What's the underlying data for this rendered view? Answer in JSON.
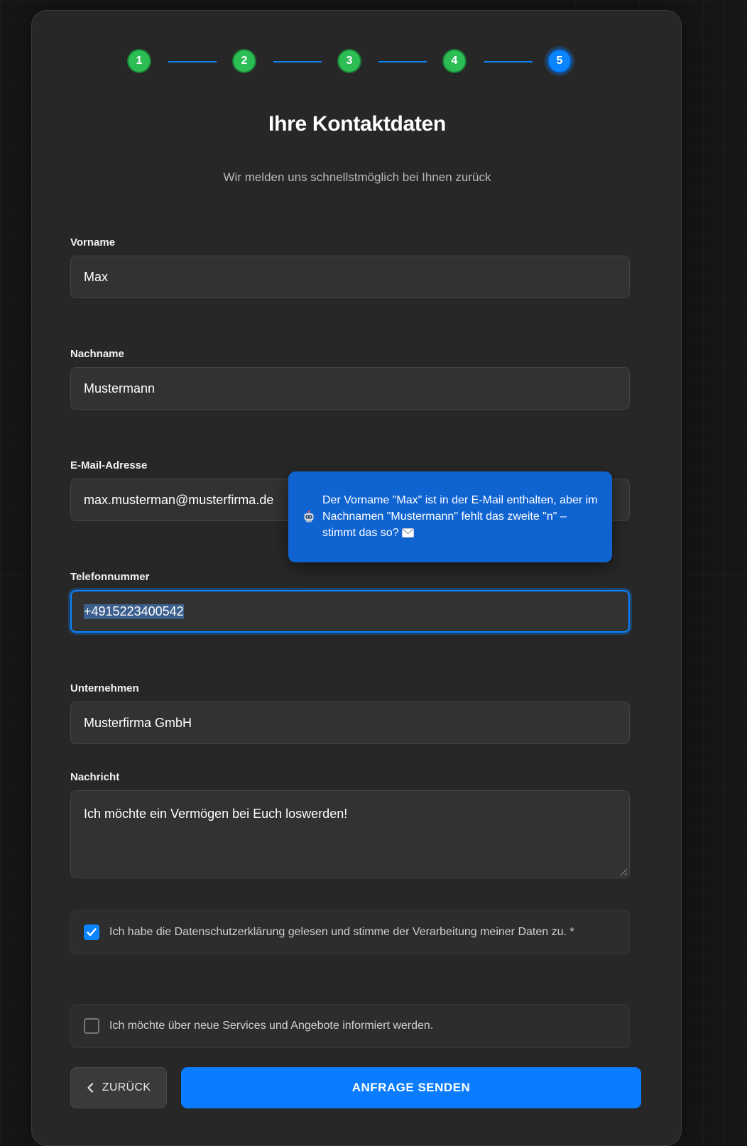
{
  "stepper": {
    "steps": [
      {
        "label": "1",
        "state": "done"
      },
      {
        "label": "2",
        "state": "done"
      },
      {
        "label": "3",
        "state": "done"
      },
      {
        "label": "4",
        "state": "done"
      },
      {
        "label": "5",
        "state": "active"
      }
    ],
    "colors": {
      "done": "#2dbd55",
      "active": "#0a84ff",
      "connector": "#0a84ff"
    }
  },
  "header": {
    "title": "Ihre Kontaktdaten",
    "subtitle": "Wir melden uns schnellstmöglich bei Ihnen zurück"
  },
  "form": {
    "first_name": {
      "label": "Vorname",
      "value": "Max"
    },
    "last_name": {
      "label": "Nachname",
      "value": "Mustermann"
    },
    "email": {
      "label": "E-Mail-Adresse",
      "value": "max.musterman@musterfirma.de"
    },
    "phone": {
      "label": "Telefonnummer",
      "value": "+4915223400542"
    },
    "company": {
      "label": "Unternehmen",
      "value": "Musterfirma GmbH"
    },
    "message": {
      "label": "Nachricht",
      "value": "Ich möchte ein Vermögen bei Euch loswerden!"
    },
    "privacy_consent": {
      "label": "Ich habe die Datenschutzerklärung gelesen und stimme der Verarbeitung meiner Daten zu. *",
      "checked": true
    },
    "newsletter_optin": {
      "label": "Ich möchte über neue Services und Angebote informiert werden.",
      "checked": false
    }
  },
  "tooltip": {
    "icon": "robot-icon",
    "text": "Der Vorname \"Max\" ist in der E-Mail enthalten, aber im Nachnamen \"Mustermann\" fehlt das zweite \"n\" – stimmt das so?",
    "trailing_icon": "envelope-icon"
  },
  "actions": {
    "back_label": "ZURÜCK",
    "send_label": "ANFRAGE SENDEN"
  },
  "colors": {
    "accent": "#0a84ff",
    "card": "#272727",
    "input": "#323232"
  }
}
